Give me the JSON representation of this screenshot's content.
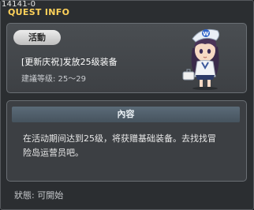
{
  "window": {
    "id_label": "14141-0",
    "title": "QUEST INFO"
  },
  "quest": {
    "category_badge": "活動",
    "name": "[更新庆祝]发放25级装备",
    "level_requirement": "建議等级: 25～29"
  },
  "content": {
    "header": "內容",
    "description_line1": "在活动期间达到25级，将获赠基础装备。去找找冒",
    "description_line2": "险岛运营员吧。"
  },
  "status": {
    "text": "狀態: 可開始"
  },
  "colors": {
    "title": "#ffd25a",
    "background": "#2b2e31",
    "header_bar": "#52606b"
  }
}
